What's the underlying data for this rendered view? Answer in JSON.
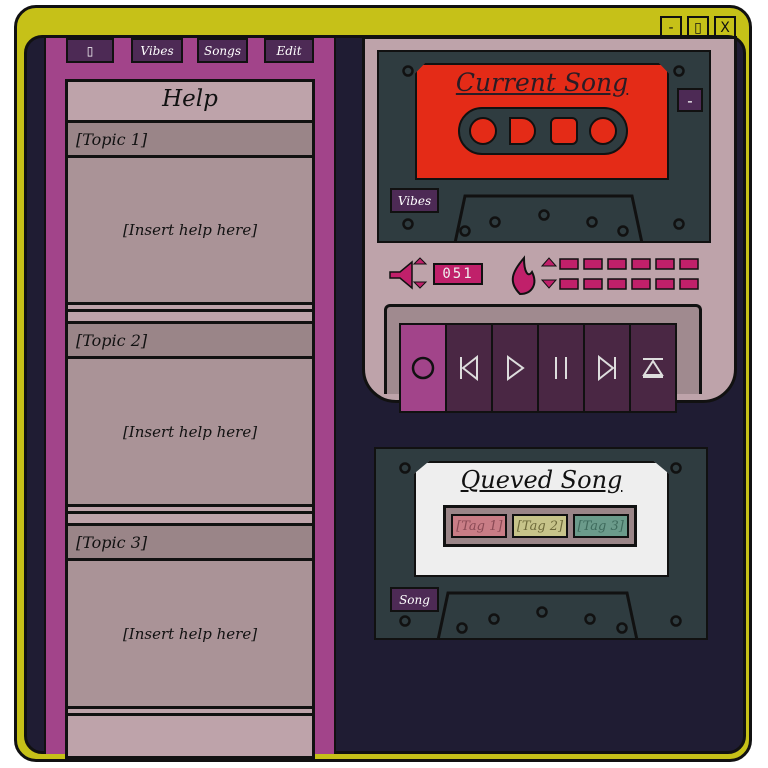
{
  "window": {
    "controls": [
      "-",
      "▯",
      "X"
    ]
  },
  "nav": {
    "items": [
      "▯",
      "Vibes",
      "Songs",
      "Edit"
    ]
  },
  "help": {
    "title": "Help",
    "topics": [
      {
        "title": "[Topic 1]",
        "body": "[Insert help here]"
      },
      {
        "title": "[Topic 2]",
        "body": "[Insert help here]"
      },
      {
        "title": "[Topic 3]",
        "body": "[Insert help here]"
      }
    ]
  },
  "current": {
    "title": "Current Song",
    "button": "Vibes",
    "minimize": "-",
    "counter": "051"
  },
  "queued": {
    "title": "Queved Song",
    "button": "Song",
    "tags": [
      "[Tag 1]",
      "[Tag 2]",
      "[Tag 3]"
    ]
  },
  "controls": [
    {
      "icon": "record-icon"
    },
    {
      "icon": "skip-back-icon"
    },
    {
      "icon": "play-icon"
    },
    {
      "icon": "pause-icon"
    },
    {
      "icon": "skip-forward-icon"
    },
    {
      "icon": "eject-icon"
    }
  ],
  "colors": {
    "frame": "#c6c118",
    "panel": "#a2448a",
    "button": "#4d2a55",
    "label": "#e42b17",
    "tag1": "#c97d86",
    "tag2": "#c7c48a",
    "tag3": "#6b9b8b"
  }
}
